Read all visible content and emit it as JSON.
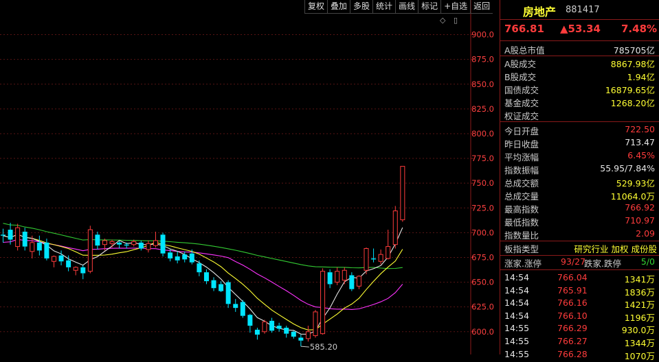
{
  "toolbar": {
    "buttons": [
      "复权",
      "叠加",
      "多股",
      "统计",
      "画线",
      "标记",
      "+自选",
      "返回"
    ],
    "icons": [
      "◇",
      "▯"
    ]
  },
  "colors": {
    "up": "#ff3c3c",
    "down": "#00e5ff",
    "ma5": "#e6e6e6",
    "ma10": "#ffff33",
    "ma20": "#ff33ff",
    "ma60": "#33cc33"
  },
  "chart_data": {
    "type": "candlestick",
    "y_ticks": [
      "900.0",
      "875.0",
      "850.0",
      "825.0",
      "800.0",
      "775.0",
      "750.0",
      "725.0",
      "700.0",
      "675.0",
      "650.0",
      "625.0",
      "600.0"
    ],
    "ylim": [
      577,
      935
    ],
    "min_label": "585.20",
    "candles": [
      {
        "o": 698,
        "c": 697,
        "h": 704,
        "l": 690
      },
      {
        "o": 703,
        "c": 693,
        "h": 710,
        "l": 688
      },
      {
        "o": 686,
        "c": 705,
        "h": 709,
        "l": 682
      },
      {
        "o": 701,
        "c": 686,
        "h": 705,
        "l": 682
      },
      {
        "o": 681,
        "c": 690,
        "h": 697,
        "l": 674
      },
      {
        "o": 690,
        "c": 682,
        "h": 697,
        "l": 677
      },
      {
        "o": 690,
        "c": 674,
        "h": 694,
        "l": 672
      },
      {
        "o": 671,
        "c": 676,
        "h": 677,
        "l": 665
      },
      {
        "o": 677,
        "c": 671,
        "h": 682,
        "l": 667
      },
      {
        "o": 672,
        "c": 665,
        "h": 677,
        "l": 661
      },
      {
        "o": 662,
        "c": 665,
        "h": 666,
        "l": 657
      },
      {
        "o": 665,
        "c": 659,
        "h": 667,
        "l": 653
      },
      {
        "o": 661,
        "c": 703,
        "h": 707,
        "l": 659
      },
      {
        "o": 698,
        "c": 687,
        "h": 701,
        "l": 683
      },
      {
        "o": 688,
        "c": 692,
        "h": 694,
        "l": 682
      },
      {
        "o": 689,
        "c": 691,
        "h": 693,
        "l": 685
      },
      {
        "o": 690,
        "c": 688,
        "h": 692,
        "l": 684
      },
      {
        "o": 688,
        "c": 687,
        "h": 690,
        "l": 684
      },
      {
        "o": 688,
        "c": 691,
        "h": 693,
        "l": 686
      },
      {
        "o": 690,
        "c": 684,
        "h": 692,
        "l": 682
      },
      {
        "o": 683,
        "c": 689,
        "h": 692,
        "l": 680
      },
      {
        "o": 687,
        "c": 692,
        "h": 701,
        "l": 685
      },
      {
        "o": 698,
        "c": 679,
        "h": 700,
        "l": 676
      },
      {
        "o": 680,
        "c": 674,
        "h": 683,
        "l": 671
      },
      {
        "o": 676,
        "c": 672,
        "h": 681,
        "l": 669
      },
      {
        "o": 678,
        "c": 673,
        "h": 681,
        "l": 670
      },
      {
        "o": 679,
        "c": 670,
        "h": 683,
        "l": 668
      },
      {
        "o": 669,
        "c": 660,
        "h": 672,
        "l": 656
      },
      {
        "o": 660,
        "c": 651,
        "h": 663,
        "l": 648
      },
      {
        "o": 652,
        "c": 644,
        "h": 655,
        "l": 641
      },
      {
        "o": 648,
        "c": 641,
        "h": 651,
        "l": 640
      },
      {
        "o": 650,
        "c": 628,
        "h": 652,
        "l": 624
      },
      {
        "o": 628,
        "c": 624,
        "h": 633,
        "l": 620
      },
      {
        "o": 630,
        "c": 616,
        "h": 632,
        "l": 614
      },
      {
        "o": 617,
        "c": 606,
        "h": 618,
        "l": 599
      },
      {
        "o": 602,
        "c": 597,
        "h": 604,
        "l": 592
      },
      {
        "o": 600,
        "c": 610,
        "h": 612,
        "l": 598
      },
      {
        "o": 611,
        "c": 601,
        "h": 614,
        "l": 599
      },
      {
        "o": 606,
        "c": 603,
        "h": 609,
        "l": 600
      },
      {
        "o": 604,
        "c": 598,
        "h": 606,
        "l": 594
      },
      {
        "o": 600,
        "c": 595,
        "h": 601,
        "l": 593
      },
      {
        "o": 594,
        "c": 591,
        "h": 597,
        "l": 585.2
      },
      {
        "o": 593,
        "c": 600,
        "h": 606,
        "l": 590
      },
      {
        "o": 596,
        "c": 620,
        "h": 622,
        "l": 594
      },
      {
        "o": 598,
        "c": 661,
        "h": 664,
        "l": 597
      },
      {
        "o": 660,
        "c": 648,
        "h": 663,
        "l": 644
      },
      {
        "o": 650,
        "c": 661,
        "h": 665,
        "l": 647
      },
      {
        "o": 652,
        "c": 662,
        "h": 665,
        "l": 648
      },
      {
        "o": 657,
        "c": 643,
        "h": 660,
        "l": 641
      },
      {
        "o": 646,
        "c": 656,
        "h": 657,
        "l": 643
      },
      {
        "o": 662,
        "c": 684,
        "h": 685,
        "l": 658
      },
      {
        "o": 674,
        "c": 673,
        "h": 684,
        "l": 670
      },
      {
        "o": 671,
        "c": 678,
        "h": 683,
        "l": 668
      },
      {
        "o": 674,
        "c": 686,
        "h": 703,
        "l": 673
      },
      {
        "o": 688,
        "c": 722,
        "h": 727,
        "l": 684
      },
      {
        "o": 713,
        "c": 767,
        "h": 767,
        "l": 711
      }
    ]
  },
  "stock": {
    "name": "房地产",
    "code": "881417"
  },
  "quote": {
    "price": "766.81",
    "change": "▲53.34",
    "pct": "7.48%"
  },
  "market": [
    {
      "label": "A股总市值",
      "value": "785705亿"
    },
    {
      "label": "A股成交",
      "value": "8867.98亿"
    },
    {
      "label": "B股成交",
      "value": "1.94亿"
    },
    {
      "label": "国债成交",
      "value": "16879.65亿"
    },
    {
      "label": "基金成交",
      "value": "1268.20亿"
    },
    {
      "label": "权证成交",
      "value": ""
    }
  ],
  "stats": [
    {
      "label": "今日开盘",
      "value": "722.50",
      "color": "red"
    },
    {
      "label": "昨日收盘",
      "value": "713.47",
      "color": "wht"
    },
    {
      "label": "平均涨幅",
      "value": "6.45%",
      "color": "red"
    },
    {
      "label": "指数振幅",
      "value": "55.95/7.84%",
      "color": "wht"
    },
    {
      "label": "总成交额",
      "value": "529.93亿",
      "color": "yel"
    },
    {
      "label": "总成交量",
      "value": "11064.0万",
      "color": "yel"
    },
    {
      "label": "最高指数",
      "value": "766.92",
      "color": "red"
    },
    {
      "label": "最低指数",
      "value": "710.97",
      "color": "red"
    },
    {
      "label": "指数量比",
      "value": "2.09",
      "color": "red"
    }
  ],
  "board": {
    "label": "板指类型",
    "value": "研究行业 加权 成份股"
  },
  "breadth": {
    "up_label": "涨家.涨停",
    "up_value": "93/27",
    "down_label": "跌家.跌停",
    "down_value": "5/0"
  },
  "ticks": [
    {
      "time": "14:54",
      "price": "766.04",
      "vol": "1341万"
    },
    {
      "time": "14:54",
      "price": "765.91",
      "vol": "1836万"
    },
    {
      "time": "14:54",
      "price": "766.16",
      "vol": "1421万"
    },
    {
      "time": "14:54",
      "price": "766.10",
      "vol": "1196万"
    },
    {
      "time": "14:55",
      "price": "766.29",
      "vol": "930.0万"
    },
    {
      "time": "14:55",
      "price": "766.27",
      "vol": "1344万"
    },
    {
      "time": "14:55",
      "price": "766.28",
      "vol": "1070万"
    }
  ]
}
